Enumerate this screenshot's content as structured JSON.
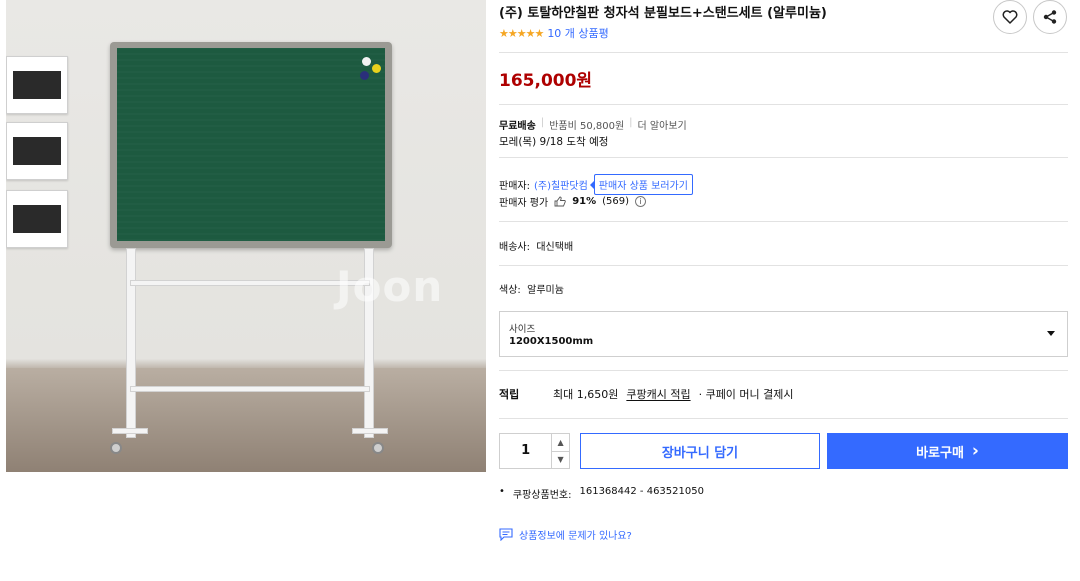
{
  "photo": {
    "alt_icon": "product-image",
    "watermark": "Joon"
  },
  "product": {
    "title": "(주) 토탈하얀칠판 청자석 분필보드+스탠드세트 (알루미늄)",
    "stars_glyphs": "★★★★★",
    "review_count": "10 개 상품평",
    "price": "165,000원"
  },
  "actions": {
    "wishlist_icon": "heart-icon",
    "share_icon": "share-icon"
  },
  "shipping": {
    "free_label": "무료배송",
    "return_fee": "반품비 50,800원",
    "more": "더 알아보기",
    "arrival": "모레(목) 9/18 도착 예정"
  },
  "seller": {
    "label": "판매자:",
    "name": "(주)칠판닷컴",
    "button": "판매자 상품 보러가기",
    "eval_label": "판매자 평가",
    "eval_pct": "91%",
    "eval_count": "(569)"
  },
  "delivery": {
    "label": "배송사:",
    "value": "대신택배"
  },
  "color": {
    "label": "색상:",
    "value": "알루미늄"
  },
  "size": {
    "label": "사이즈",
    "value": "1200X1500mm"
  },
  "reward": {
    "label": "적립",
    "max": "최대 1,650원",
    "link": "쿠팡캐시 적립",
    "suffix": "· 쿠페이 머니 결제시"
  },
  "purchase": {
    "quantity": "1",
    "cart": "장바구니 담기",
    "buy": "바로구매",
    "buy_arrow": "›"
  },
  "product_id": {
    "label": "쿠팡상품번호:",
    "value": "161368442 - 463521050"
  },
  "report": {
    "text": "상품정보에 문제가 있나요?"
  },
  "colors": {
    "accent": "#346aff",
    "price": "#ae0000",
    "star": "#f5a623",
    "board": "#1d5a40"
  }
}
